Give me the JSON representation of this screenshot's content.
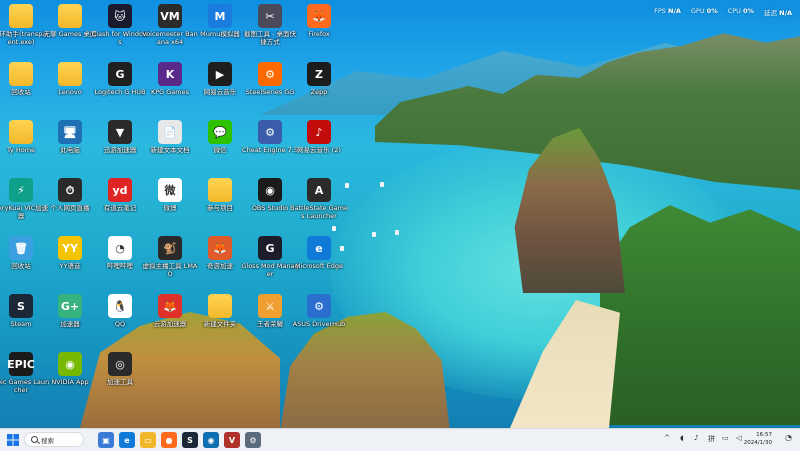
{
  "perf": {
    "fps_label": "FPS",
    "fps_value": "N/A",
    "gpu_label": "GPU",
    "gpu_value": "0%",
    "cpu_label": "CPU",
    "cpu_value": "0%",
    "ram_label": "延迟",
    "ram_value": "N/A"
  },
  "desktop": {
    "icons": [
      {
        "label": "光环助手(transparent.exe)",
        "type": "folder"
      },
      {
        "label": "无聊 Games 桌面",
        "type": "folder"
      },
      {
        "label": "Clash for Windows",
        "type": "app",
        "color": "#1a1a2e",
        "glyph": "🐱"
      },
      {
        "label": "Voicemeeter Banana x64",
        "type": "app",
        "color": "#2b2b2b",
        "glyph": "VM"
      },
      {
        "label": "Mumu模拟器",
        "type": "app",
        "color": "#1b7ce0",
        "glyph": "M"
      },
      {
        "label": "截图工具 - 桌面快捷方式",
        "type": "app",
        "color": "#4a4a5a",
        "glyph": "✂"
      },
      {
        "label": "Firefox",
        "type": "app",
        "color": "#ff6a1f",
        "glyph": "🦊"
      },
      {
        "label": "回收站",
        "type": "folder"
      },
      {
        "label": "Lenovo",
        "type": "folder"
      },
      {
        "label": "Logitech G HUB",
        "type": "app",
        "color": "#202020",
        "glyph": "G"
      },
      {
        "label": "KPG Games",
        "type": "app",
        "color": "#5a2a8a",
        "glyph": "K"
      },
      {
        "label": "网易云音乐",
        "type": "app",
        "color": "#1e1e1e",
        "glyph": "▶"
      },
      {
        "label": "SteelSeries GG",
        "type": "app",
        "color": "#ff6a00",
        "glyph": "⚙"
      },
      {
        "label": "Zepp",
        "type": "app",
        "color": "#1c1c1c",
        "glyph": "Z"
      },
      {
        "label": "Ty Home",
        "type": "folder"
      },
      {
        "label": "此电脑",
        "type": "app",
        "color": "#1f6fb5",
        "glyph": "🖥"
      },
      {
        "label": "迅游加速器",
        "type": "app",
        "color": "#2a2a2a",
        "glyph": "▼"
      },
      {
        "label": "新建文本文档",
        "type": "app",
        "color": "#e8e8e8",
        "glyph": "📄"
      },
      {
        "label": "微信",
        "type": "app",
        "color": "#2dc100",
        "glyph": "💬"
      },
      {
        "label": "Cheat Engine 7.5",
        "type": "app",
        "color": "#3b5ca8",
        "glyph": "⚙"
      },
      {
        "label": "网易云音乐 (2)",
        "type": "app",
        "color": "#c20c0c",
        "glyph": "♪"
      },
      {
        "label": "VeryKuai VIC加速器",
        "type": "app",
        "color": "#0fa08a",
        "glyph": "⚡"
      },
      {
        "label": "个人网页直播",
        "type": "app",
        "color": "#2a2a2a",
        "glyph": "⏱"
      },
      {
        "label": "有道云笔记",
        "type": "app",
        "color": "#e02424",
        "glyph": "yd"
      },
      {
        "label": "微博",
        "type": "app",
        "color": "#ffffff",
        "glyph": "微"
      },
      {
        "label": "参与项目",
        "type": "folder"
      },
      {
        "label": "OBS Studio",
        "type": "app",
        "color": "#1b1b1b",
        "glyph": "◉"
      },
      {
        "label": "BattleState Games Launcher",
        "type": "app",
        "color": "#2b2b2b",
        "glyph": "A"
      },
      {
        "label": "回收站",
        "type": "app",
        "color": "#3aa0e0",
        "glyph": "🗑"
      },
      {
        "label": "YY语音",
        "type": "app",
        "color": "#f5c400",
        "glyph": "YY"
      },
      {
        "label": "哔哩哔哩",
        "type": "app",
        "color": "#ffffff",
        "glyph": "◔"
      },
      {
        "label": "虚拟主播工具 LMAO",
        "type": "app",
        "color": "#2a2a2a",
        "glyph": "🐒"
      },
      {
        "label": "奇游加速",
        "type": "app",
        "color": "#e05a2a",
        "glyph": "🦊"
      },
      {
        "label": "Gloss Mod Manager",
        "type": "app",
        "color": "#1c1c2a",
        "glyph": "G"
      },
      {
        "label": "Microsoft Edge",
        "type": "app",
        "color": "#0f7ad8",
        "glyph": "e"
      },
      {
        "label": "Steam",
        "type": "app",
        "color": "#1b2838",
        "glyph": "S"
      },
      {
        "label": "加速器",
        "type": "app",
        "color": "#36b37e",
        "glyph": "G+"
      },
      {
        "label": "QQ",
        "type": "app",
        "color": "#ffffff",
        "glyph": "🐧"
      },
      {
        "label": "云游加速器",
        "type": "app",
        "color": "#e0302a",
        "glyph": "🦊"
      },
      {
        "label": "新建文件夹",
        "type": "folder"
      },
      {
        "label": "王者荣耀",
        "type": "app",
        "color": "#f0a030",
        "glyph": "⚔"
      },
      {
        "label": "ASUS DriverHub",
        "type": "app",
        "color": "#2a6fd0",
        "glyph": "⚙"
      },
      {
        "label": "Epic Games Launcher",
        "type": "app",
        "color": "#1b1b1b",
        "glyph": "EPIC"
      },
      {
        "label": "NVIDIA App",
        "type": "app",
        "color": "#76b900",
        "glyph": "◉"
      },
      {
        "label": "加速工具",
        "type": "app",
        "color": "#2a2a2a",
        "glyph": "◎"
      }
    ]
  },
  "taskbar": {
    "search_placeholder": "搜索",
    "clock_time": "16:57",
    "clock_date": "2024/1/30",
    "items": [
      {
        "name": "task-view",
        "color": "#3a7bd5",
        "glyph": "▣"
      },
      {
        "name": "edge",
        "color": "#0f7ad8",
        "glyph": "e"
      },
      {
        "name": "file-explorer",
        "color": "#f3b82a",
        "glyph": "▭"
      },
      {
        "name": "firefox",
        "color": "#ff6a1f",
        "glyph": "●"
      },
      {
        "name": "steam",
        "color": "#1b2838",
        "glyph": "S"
      },
      {
        "name": "app-blue",
        "color": "#0f6fb0",
        "glyph": "◉"
      },
      {
        "name": "voicemeeter",
        "color": "#b0302a",
        "glyph": "V"
      },
      {
        "name": "settings",
        "color": "#5a6b7b",
        "glyph": "⚙"
      }
    ]
  }
}
